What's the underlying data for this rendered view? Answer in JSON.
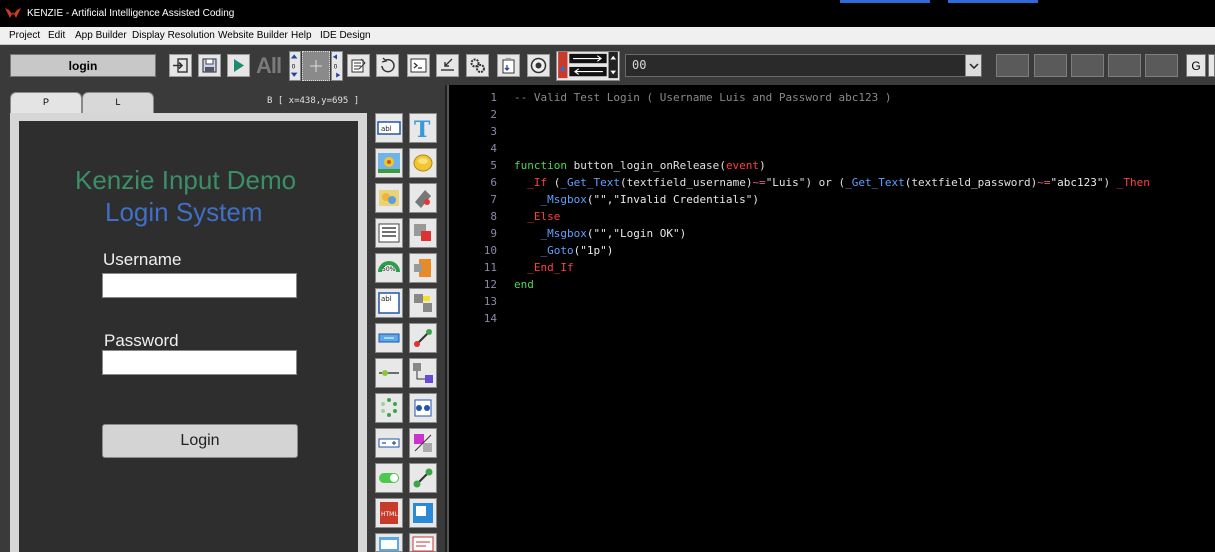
{
  "window": {
    "title": "KENZIE - Artificial Intelligence Assisted Coding"
  },
  "menu": [
    "Project",
    "Edit",
    "App Builder",
    "Display Resolution",
    "Website Builder",
    "Help",
    "IDE Design"
  ],
  "toolbar": {
    "page_selector": "login",
    "all_label": "All",
    "combo_value": "00",
    "extra_button": "G"
  },
  "left_tabs": [
    "P",
    "L"
  ],
  "coords_readout": "B [ x=438,y=695 ]",
  "app_preview": {
    "title_line1": "Kenzie Input Demo",
    "title_line2": "Login System",
    "username_label": "Username",
    "password_label": "Password",
    "login_button": "Login"
  },
  "colors": {
    "title_green": "#3a8f68",
    "title_blue": "#3f6fc6",
    "keyword_green": "#4fd64f",
    "macro_red": "#ff4040",
    "call_blue": "#5fa0ff"
  },
  "code": {
    "line_numbers": [
      "1",
      "2",
      "3",
      "4",
      "5",
      "6",
      "7",
      "8",
      "9",
      "10",
      "11",
      "12",
      "13",
      "14"
    ],
    "l1": "-- Valid Test Login ( Username Luis and Password abc123 )",
    "l5_kw": "function",
    "l5_name": " button_login_onRelease",
    "l5_paren": "(",
    "l5_arg": "event",
    "l5_close": ")",
    "l6_if": "_If",
    "l6_a": " (",
    "l6_call1": "_Get_Text",
    "l6_b": "(textfield_username)",
    "l6_op1": "~=",
    "l6_s1": "\"Luis\"",
    "l6_c": ") or (",
    "l6_call2": "_Get_Text",
    "l6_d": "(textfield_password)",
    "l6_op2": "~=",
    "l6_s2": "\"abc123\"",
    "l6_e": ") ",
    "l6_then": "_Then",
    "l7_call": "_Msgbox",
    "l7_args": "(\"\",\"Invalid Credentials\")",
    "l8_else": "_Else",
    "l9_call": "_Msgbox",
    "l9_args": "(\"\",\"Login OK\")",
    "l10_call": "_Goto",
    "l10_args": "(\"1p\")",
    "l11_endif": "_End_If",
    "l12_end": "end"
  }
}
